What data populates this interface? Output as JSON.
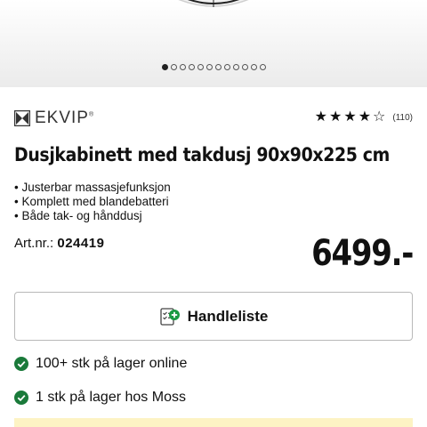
{
  "gallery": {
    "slide_count": 12,
    "active_index": 0
  },
  "brand": {
    "name": "EKVIP",
    "tm": "®",
    "icon": "ekvip-logo-icon"
  },
  "rating": {
    "stars": 4,
    "max": 5,
    "count": "(110)"
  },
  "product": {
    "title": "Dusjkabinett med takdusj 90x90x225 cm",
    "features": [
      "Justerbar massasjefunksjon",
      "Komplett med blandebatteri",
      "Både tak- og hånddusj"
    ],
    "artnr_label": "Art.nr.:",
    "artnr_value": "024419",
    "price": "6499.-"
  },
  "shopping_list_button": {
    "label": "Handleliste",
    "icon": "shopping-list-add-icon"
  },
  "stock": [
    {
      "text": "100+ stk på lager online",
      "icon": "check-circle-icon"
    },
    {
      "text": "1 stk på lager hos Moss",
      "icon": "check-circle-icon"
    }
  ],
  "colors": {
    "accent_green": "#1a7a3a",
    "banner": "#fdf3c4"
  }
}
